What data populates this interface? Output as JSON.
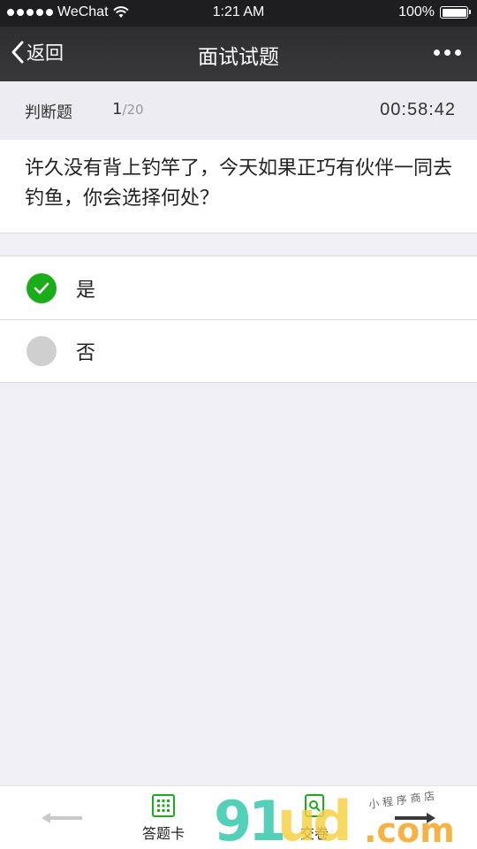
{
  "status_bar": {
    "carrier": "WeChat",
    "time": "1:21 AM",
    "battery": "100%"
  },
  "nav": {
    "back_label": "返回",
    "title": "面试试题"
  },
  "question_header": {
    "type": "判断题",
    "current": "1",
    "total": "/20",
    "timer": "00:58:42"
  },
  "question": {
    "text": "许久没有背上钓竿了，今天如果正巧有伙伴一同去钓鱼，你会选择何处？"
  },
  "options": [
    {
      "label": "是",
      "selected": true
    },
    {
      "label": "否",
      "selected": false
    }
  ],
  "tab_bar": {
    "answer_card": "答题卡",
    "submit": "交卷"
  },
  "colors": {
    "accent": "#1aad19",
    "nav_bg": "#2e2e31"
  },
  "watermark": {
    "brand": "91ud.com",
    "tagline": "小程序商店"
  }
}
